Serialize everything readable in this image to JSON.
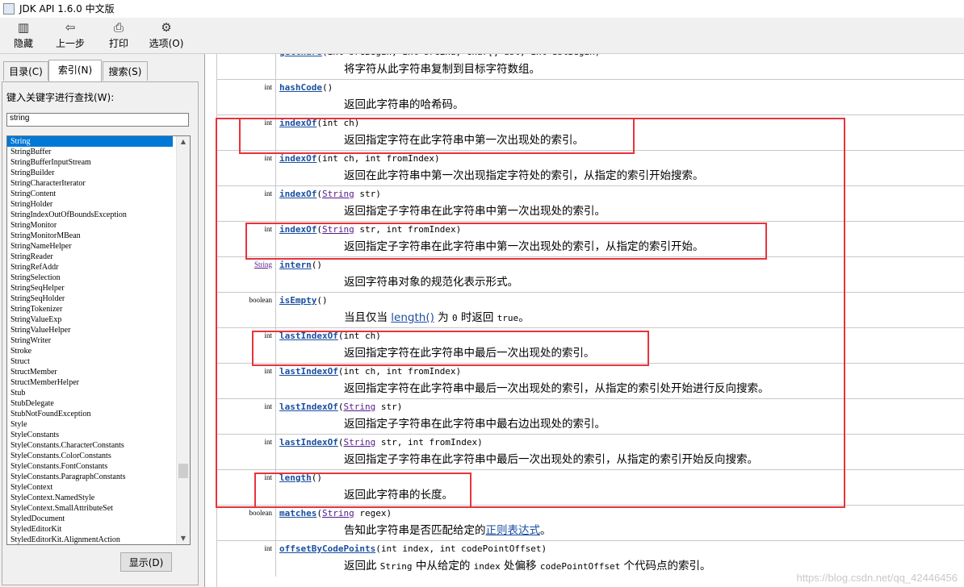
{
  "window": {
    "title": "JDK API 1.6.0 中文版"
  },
  "toolbar": {
    "hide": "隐藏",
    "back": "上一步",
    "print": "打印",
    "options": "选项(O)"
  },
  "tabs": [
    {
      "label": "目录(C)",
      "active": false
    },
    {
      "label": "索引(N)",
      "active": true
    },
    {
      "label": "搜索(S)",
      "active": false
    }
  ],
  "search": {
    "label": "键入关键字进行查找(W):",
    "value": "string"
  },
  "index_list": [
    "String",
    "StringBuffer",
    "StringBufferInputStream",
    "StringBuilder",
    "StringCharacterIterator",
    "StringContent",
    "StringHolder",
    "StringIndexOutOfBoundsException",
    "StringMonitor",
    "StringMonitorMBean",
    "StringNameHelper",
    "StringReader",
    "StringRefAddr",
    "StringSelection",
    "StringSeqHelper",
    "StringSeqHolder",
    "StringTokenizer",
    "StringValueExp",
    "StringValueHelper",
    "StringWriter",
    "Stroke",
    "Struct",
    "StructMember",
    "StructMemberHelper",
    "Stub",
    "StubDelegate",
    "StubNotFoundException",
    "Style",
    "StyleConstants",
    "StyleConstants.CharacterConstants",
    "StyleConstants.ColorConstants",
    "StyleConstants.FontConstants",
    "StyleConstants.ParagraphConstants",
    "StyleContext",
    "StyleContext.NamedStyle",
    "StyleContext.SmallAttributeSet",
    "StyledDocument",
    "StyledEditorKit",
    "StyledEditorKit.AlignmentAction"
  ],
  "display_button": "显示(D)",
  "methods": [
    {
      "type": "void",
      "name": "getChars",
      "params": "(int srcBegin, int srcEnd, char[] dst, int dstBegin)",
      "desc": "将字符从此字符串复制到目标字符数组。"
    },
    {
      "type": "int",
      "name": "hashCode",
      "params": "()",
      "desc": "返回此字符串的哈希码。"
    },
    {
      "type": "int",
      "name": "indexOf",
      "params": "(int ch)",
      "desc": "返回指定字符在此字符串中第一次出现处的索引。"
    },
    {
      "type": "int",
      "name": "indexOf",
      "params": "(int ch, int fromIndex)",
      "desc": "返回在此字符串中第一次出现指定字符处的索引，从指定的索引开始搜索。"
    },
    {
      "type": "int",
      "name": "indexOf",
      "pre": "(",
      "cls": "String",
      "params": " str)",
      "desc": "返回指定子字符串在此字符串中第一次出现处的索引。"
    },
    {
      "type": "int",
      "name": "indexOf",
      "pre": "(",
      "cls": "String",
      "params": " str, int fromIndex)",
      "desc": "返回指定子字符串在此字符串中第一次出现处的索引，从指定的索引开始。"
    },
    {
      "type": "String",
      "name": "intern",
      "params": "()",
      "desc": "返回字符串对象的规范化表示形式。"
    },
    {
      "type": "boolean",
      "name": "isEmpty",
      "params": "()",
      "desc_a": "当且仅当 ",
      "desc_link": "length()",
      "desc_b": " 为 ",
      "desc_c": "0",
      "desc_d": " 时返回 ",
      "desc_e": "true",
      "desc_f": "。"
    },
    {
      "type": "int",
      "name": "lastIndexOf",
      "params": "(int ch)",
      "desc": "返回指定字符在此字符串中最后一次出现处的索引。"
    },
    {
      "type": "int",
      "name": "lastIndexOf",
      "params": "(int ch, int fromIndex)",
      "desc": "返回指定字符在此字符串中最后一次出现处的索引，从指定的索引处开始进行反向搜索。"
    },
    {
      "type": "int",
      "name": "lastIndexOf",
      "pre": "(",
      "cls": "String",
      "params": " str)",
      "desc": "返回指定子字符串在此字符串中最右边出现处的索引。"
    },
    {
      "type": "int",
      "name": "lastIndexOf",
      "pre": "(",
      "cls": "String",
      "params": " str, int fromIndex)",
      "desc": "返回指定子字符串在此字符串中最后一次出现处的索引，从指定的索引开始反向搜索。"
    },
    {
      "type": "int",
      "name": "length",
      "params": "()",
      "desc": "返回此字符串的长度。"
    },
    {
      "type": "boolean",
      "name": "matches",
      "pre": "(",
      "cls": "String",
      "params": " regex)",
      "desc_a": "告知此字符串是否匹配给定的",
      "desc_link": "正则表达式",
      "desc_b": "。"
    },
    {
      "type": "int",
      "name": "offsetByCodePoints",
      "params": "(int index, int codePointOffset)",
      "desc_a": "返回此 ",
      "desc_c": "String",
      "desc_d": " 中从给定的 ",
      "desc_e": "index",
      "desc_f": " 处偏移 ",
      "desc_g": "codePointOffset",
      "desc_h": " 个代码点的索引。"
    }
  ],
  "watermark": "https://blog.csdn.net/qq_42446456",
  "colors": {
    "highlight": "#e8333c",
    "link": "#1a4fa0",
    "selection": "#0078d7"
  }
}
